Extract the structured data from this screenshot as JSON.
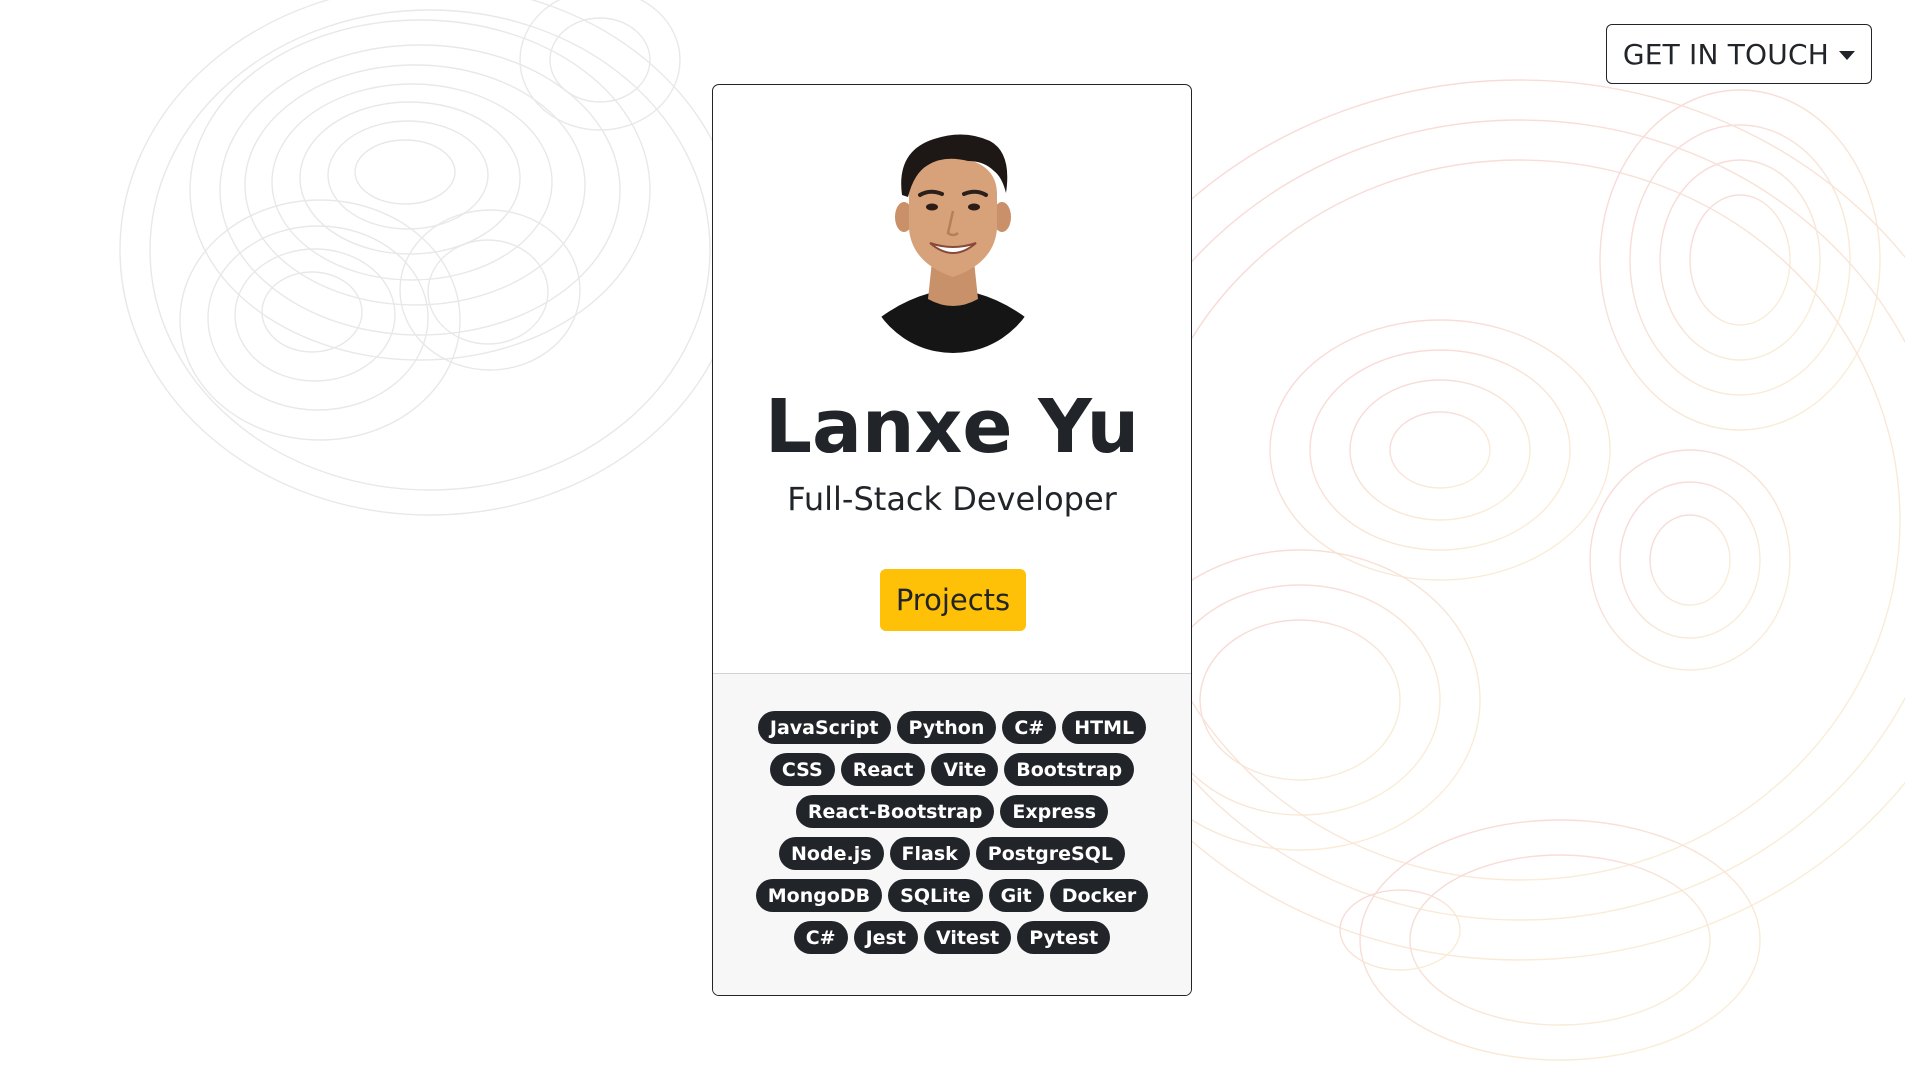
{
  "header": {
    "contact_label": "GET IN TOUCH",
    "contact_icon": "caret-down-icon"
  },
  "profile": {
    "avatar": "profile-photo",
    "name": "Lanxe Yu",
    "role": "Full-Stack Developer",
    "projects_label": "Projects"
  },
  "skills": [
    "JavaScript",
    "Python",
    "C#",
    "HTML",
    "CSS",
    "React",
    "Vite",
    "Bootstrap",
    "React-Bootstrap",
    "Express",
    "Node.js",
    "Flask",
    "PostgreSQL",
    "MongoDB",
    "SQLite",
    "Git",
    "Docker",
    "C#",
    "Jest",
    "Vitest",
    "Pytest"
  ],
  "colors": {
    "accent": "#ffc107",
    "dark": "#212529",
    "card_footer_bg": "#f7f7f7",
    "background": "#ffffff"
  }
}
